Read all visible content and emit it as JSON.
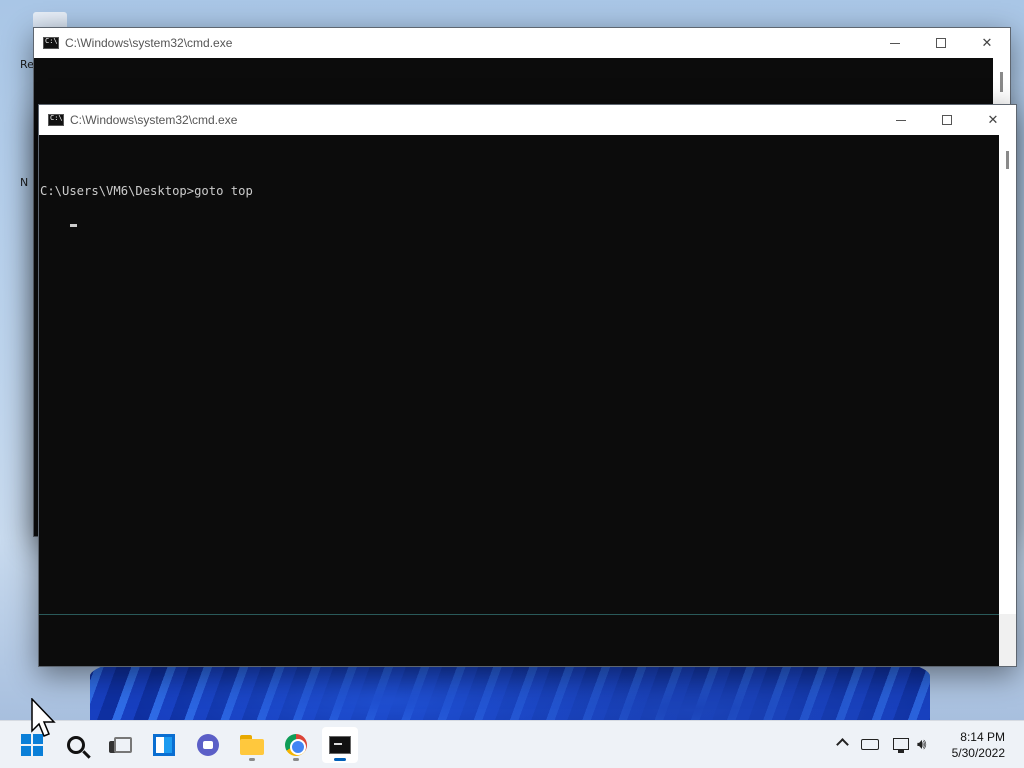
{
  "desktop": {
    "icon_labels": [
      "Re",
      "N"
    ]
  },
  "back_window": {
    "title": "C:\\Windows\\system32\\cmd.exe"
  },
  "front_window": {
    "title": "C:\\Windows\\system32\\cmd.exe",
    "console_line": "C:\\Users\\VM6\\Desktop>goto top"
  },
  "window_controls": {
    "minimize": "minimize",
    "maximize": "maximize",
    "close": "close"
  },
  "taskbar": {
    "items": [
      {
        "name": "start",
        "icon": "windows-logo-icon"
      },
      {
        "name": "search",
        "icon": "search-icon"
      },
      {
        "name": "task-view",
        "icon": "task-view-icon"
      },
      {
        "name": "widgets",
        "icon": "widgets-icon"
      },
      {
        "name": "chat",
        "icon": "teams-chat-icon"
      },
      {
        "name": "file-explorer",
        "icon": "folder-icon"
      },
      {
        "name": "chrome",
        "icon": "chrome-icon"
      },
      {
        "name": "command-prompt",
        "icon": "cmd-icon"
      }
    ],
    "clock_time": "8:14 PM",
    "clock_date": "5/30/2022"
  },
  "colors": {
    "console_bg": "#0c0c0c",
    "console_text": "#cccccc",
    "accent": "#005fb8"
  }
}
